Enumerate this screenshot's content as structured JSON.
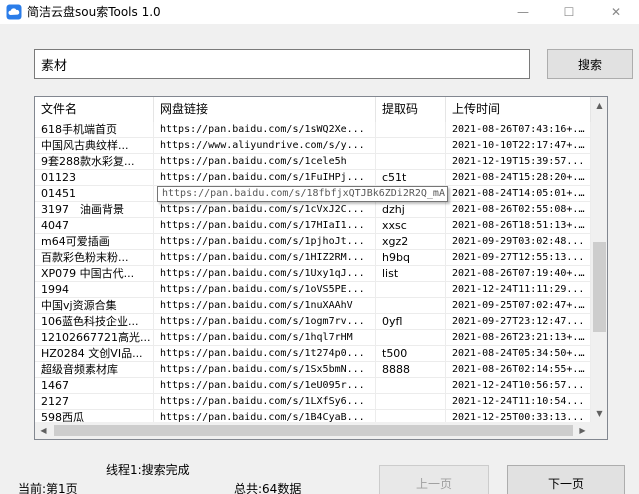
{
  "window": {
    "title": "简洁云盘sou索Tools 1.0",
    "min_glyph": "—",
    "max_glyph": "☐",
    "close_glyph": "✕"
  },
  "search": {
    "value": "素材",
    "button_label": "搜索"
  },
  "table": {
    "columns": [
      "文件名",
      "网盘链接",
      "提取码",
      "上传时间"
    ],
    "rows": [
      [
        "618手机端首页",
        "https://pan.baidu.com/s/1sWQ2Xe...",
        "",
        "2021-08-26T07:43:16+..."
      ],
      [
        "中国风古典纹样...",
        "https://www.aliyundrive.com/s/y...",
        "",
        "2021-10-10T22:17:47+..."
      ],
      [
        "9套288款水彩复...",
        "https://pan.baidu.com/s/1cele5h",
        "",
        "2021-12-19T15:39:57..."
      ],
      [
        "01123",
        "https://pan.baidu.com/s/1FuIHPj...",
        "c51t",
        "2021-08-24T15:28:20+..."
      ],
      [
        "01451",
        "",
        "",
        "2021-08-24T14:05:01+..."
      ],
      [
        "3197　油画背景",
        "https://pan.baidu.com/s/1cVxJ2C...",
        "dzhj",
        "2021-08-26T02:55:08+..."
      ],
      [
        "4047",
        "https://pan.baidu.com/s/17HIaI1...",
        "xxsc",
        "2021-08-26T18:51:13+..."
      ],
      [
        "m64可爱插画",
        "https://pan.baidu.com/s/1pjhoJt...",
        "xgz2",
        "2021-09-29T03:02:48..."
      ],
      [
        "百款彩色粉末粉...",
        "https://pan.baidu.com/s/1HIZ2RM...",
        "h9bq",
        "2021-09-27T12:55:13..."
      ],
      [
        "XP079 中国古代...",
        "https://pan.baidu.com/s/1Uxy1qJ...",
        "list",
        "2021-08-26T07:19:40+..."
      ],
      [
        "1994",
        "https://pan.baidu.com/s/1oVS5PE...",
        "",
        "2021-12-24T11:11:29..."
      ],
      [
        "中国vj资源合集",
        "https://pan.baidu.com/s/1nuXAAhV",
        "",
        "2021-09-25T07:02:47+..."
      ],
      [
        "106蓝色科技企业...",
        "https://pan.baidu.com/s/1ogm7rv...",
        "0yfl",
        "2021-09-27T23:12:47..."
      ],
      [
        "12102667721高光...",
        "https://pan.baidu.com/s/1hql7rHM",
        "",
        "2021-08-26T23:21:13+..."
      ],
      [
        "HZ0284 文创VI品...",
        "https://pan.baidu.com/s/1t274p0...",
        "t500",
        "2021-08-24T05:34:50+..."
      ],
      [
        "超级音频素材库",
        "https://pan.baidu.com/s/1Sx5bmN...",
        "8888",
        "2021-08-26T02:14:55+..."
      ],
      [
        "1467",
        "https://pan.baidu.com/s/1eU095r...",
        "",
        "2021-12-24T10:56:57..."
      ],
      [
        "2127",
        "https://pan.baidu.com/s/1LXfSy6...",
        "",
        "2021-12-24T11:10:54..."
      ],
      [
        "598西瓜",
        "https://pan.baidu.com/s/1B4CyaB...",
        "",
        "2021-12-25T00:33:13..."
      ]
    ]
  },
  "tooltip": "https://pan.baidu.com/s/18fbfjxQTJBk6ZDi2R2Q_mA",
  "status": {
    "thread": "线程1:搜索完成",
    "page": "当前:第1页",
    "total": "总共:64数据"
  },
  "pager": {
    "prev_label": "上一页",
    "next_label": "下一页"
  },
  "scroll_glyphs": {
    "up": "▲",
    "down": "▼",
    "left": "◀",
    "right": "▶"
  }
}
